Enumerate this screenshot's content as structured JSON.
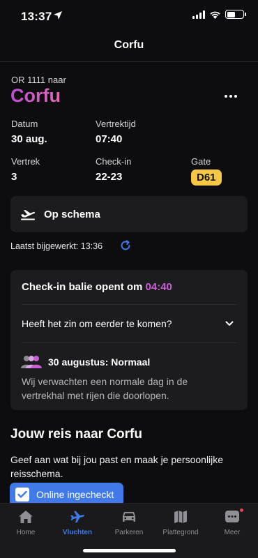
{
  "status": {
    "time": "13:37"
  },
  "nav": {
    "title": "Corfu"
  },
  "flight": {
    "subtitle": "OR 1111 naar",
    "destination": "Corfu",
    "datum_label": "Datum",
    "datum_value": "30 aug.",
    "vertrektijd_label": "Vertrektijd",
    "vertrektijd_value": "07:40",
    "vertrek_label": "Vertrek",
    "vertrek_value": "3",
    "checkin_label": "Check-in",
    "checkin_value": "22-23",
    "gate_label": "Gate",
    "gate_value": "D61"
  },
  "flight_status": {
    "label": "Op schema"
  },
  "last_updated": "Laatst bijgewerkt: 13:36",
  "checkin_card": {
    "title_prefix": "Check-in balie opent om",
    "open_time": "04:40",
    "question": "Heeft het zin om eerder te komen?",
    "day_label": "30 augustus: Normaal",
    "description": "Wij verwachten een normale dag in de vertrekhal met rijen die doorlopen."
  },
  "trip": {
    "title": "Jouw reis naar Corfu",
    "description": "Geef aan wat bij jou past en maak je persoonlijke reisschema.",
    "chip_label": "Online ingecheckt"
  },
  "tabs": [
    {
      "label": "Home",
      "icon": "home-icon"
    },
    {
      "label": "Vluchten",
      "icon": "plane-icon"
    },
    {
      "label": "Parkeren",
      "icon": "car-icon"
    },
    {
      "label": "Plattegrond",
      "icon": "map-icon"
    },
    {
      "label": "Meer",
      "icon": "chat-icon"
    }
  ],
  "colors": {
    "accent": "#3f7ae8",
    "gate": "#f6c744",
    "highlight": "#c95fd2",
    "background": "#0d0d0f",
    "card": "#1c1c1f"
  }
}
